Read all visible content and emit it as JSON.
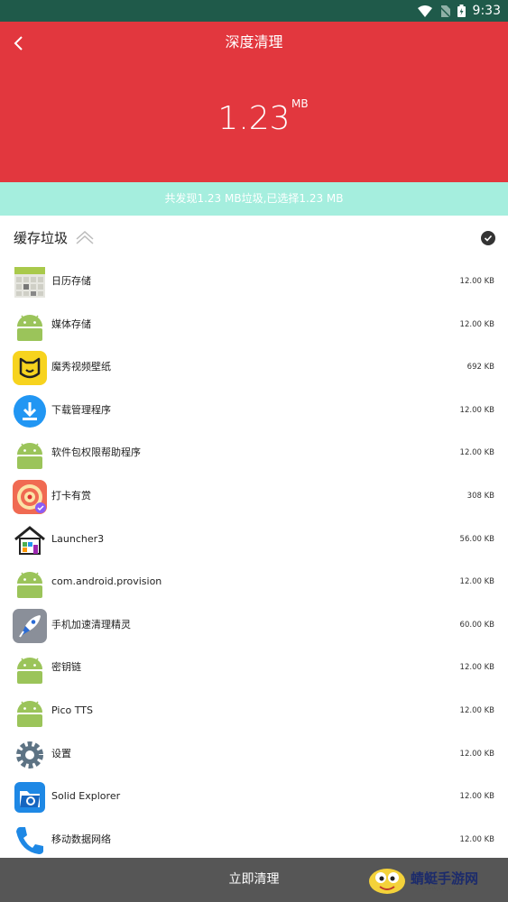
{
  "status_bar": {
    "time": "9:33"
  },
  "header": {
    "title": "深度清理",
    "size_value": "1.23",
    "size_unit": "MB"
  },
  "summary": {
    "text": "共发现1.23 MB垃圾,已选择1.23 MB"
  },
  "section": {
    "title": "缓存垃圾"
  },
  "apps": [
    {
      "name": "日历存储",
      "size": "12.00 KB",
      "icon": "calendar-icon"
    },
    {
      "name": "媒体存储",
      "size": "12.00 KB",
      "icon": "android-icon"
    },
    {
      "name": "魔秀视频壁纸",
      "size": "692 KB",
      "icon": "cat-face-icon"
    },
    {
      "name": "下载管理程序",
      "size": "12.00 KB",
      "icon": "download-icon"
    },
    {
      "name": "软件包权限帮助程序",
      "size": "12.00 KB",
      "icon": "android-icon"
    },
    {
      "name": "打卡有赏",
      "size": "308 KB",
      "icon": "target-icon"
    },
    {
      "name": "Launcher3",
      "size": "56.00 KB",
      "icon": "home-icon"
    },
    {
      "name": "com.android.provision",
      "size": "12.00 KB",
      "icon": "android-icon"
    },
    {
      "name": "手机加速清理精灵",
      "size": "60.00 KB",
      "icon": "rocket-icon"
    },
    {
      "name": "密钥链",
      "size": "12.00 KB",
      "icon": "android-icon"
    },
    {
      "name": "Pico TTS",
      "size": "12.00 KB",
      "icon": "android-icon"
    },
    {
      "name": "设置",
      "size": "12.00 KB",
      "icon": "gear-icon"
    },
    {
      "name": "Solid Explorer",
      "size": "12.00 KB",
      "icon": "folder-icon"
    },
    {
      "name": "移动数据网络",
      "size": "12.00 KB",
      "icon": "phone-icon"
    }
  ],
  "bottom": {
    "button_label": "立即清理",
    "watermark": "蜻蜓手游网",
    "watermark_url": "www.QT6.com"
  },
  "colors": {
    "header": "#e2373e",
    "summary": "#a5eede",
    "status": "#1f5a4a",
    "bottom": "#565656"
  }
}
